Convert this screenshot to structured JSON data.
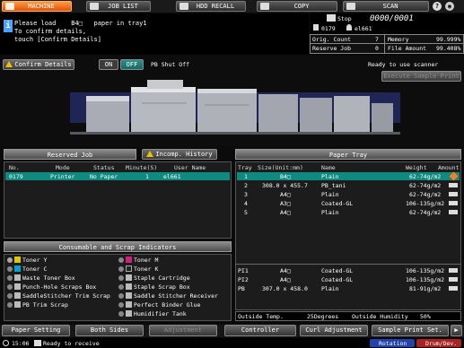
{
  "tabs": {
    "machine": "MACHINE",
    "job_list": "JOB LIST",
    "hdd_recall": "HDD RECALL",
    "copy": "COPY",
    "scan": "SCAN"
  },
  "message": {
    "line1": "Please load    B4□   paper in tray1",
    "line2": "To confirm details,",
    "line3": "touch [Confirm Details]"
  },
  "status": {
    "state": "Stop",
    "counter": "0000/0001",
    "job_id": "0179",
    "user": "el661",
    "orig_count_label": "Orig. Count",
    "orig_count": "7",
    "memory_label": "Memory",
    "memory": "99.999%",
    "reserve_job_label": "Reserve Job",
    "reserve_job": "0",
    "file_amount_label": "File Amount",
    "file_amount": "99.408%"
  },
  "controls": {
    "confirm_details": "Confirm Details",
    "on": "ON",
    "off": "OFF",
    "pb_shut_off": "PB Shut Off",
    "scanner_status": "Ready to use scanner",
    "execute_sample_print": "Execute Sample Print"
  },
  "reserved_job": {
    "title": "Reserved Job",
    "incomp_history": "Incomp. History",
    "headers": [
      "No.",
      "Mode",
      "Status",
      "Minute(S)",
      "User Name"
    ],
    "rows": [
      {
        "no": "0179",
        "mode": "Printer",
        "status": "No Paper",
        "minutes": "1",
        "user": "el661"
      }
    ]
  },
  "consumables": {
    "title": "Consumable and Scrap Indicators",
    "left": [
      "Toner Y",
      "Toner C",
      "Waste Toner Box",
      "Punch-Hole Scraps Box",
      "SaddleStitcher Trim Scrap",
      "PB Trim Scrap"
    ],
    "right": [
      "Toner M",
      "Toner K",
      "Staple Cartridge",
      "Staple Scrap Box",
      "Saddle Stitcher Receiver",
      "Perfect Binder Glue",
      "Humidifier Tank"
    ]
  },
  "paper_tray": {
    "title": "Paper Tray",
    "headers": [
      "Tray",
      "Size(Unit:mm)",
      "Name",
      "Weight",
      "Amount"
    ],
    "rows": [
      {
        "tray": "1",
        "size": "B4□",
        "name": "Plain",
        "weight": "62-74g/m2"
      },
      {
        "tray": "2",
        "size": "308.0 x 455.7",
        "name": "PB_tani",
        "weight": "62-74g/m2"
      },
      {
        "tray": "3",
        "size": "A4□",
        "name": "Plain",
        "weight": "62-74g/m2"
      },
      {
        "tray": "4",
        "size": "A3□",
        "name": "Coated-GL",
        "weight": "106-135g/m2"
      },
      {
        "tray": "5",
        "size": "A4□",
        "name": "Plain",
        "weight": "62-74g/m2"
      }
    ],
    "lower_rows": [
      {
        "tray": "PI1",
        "size": "A4□",
        "name": "Coated-GL",
        "weight": "106-135g/m2"
      },
      {
        "tray": "PI2",
        "size": "A4□",
        "name": "Coated-GL",
        "weight": "106-135g/m2"
      },
      {
        "tray": "PB",
        "size": "307.0 x 458.0",
        "name": "Plain",
        "weight": "81-91g/m2"
      }
    ],
    "outside_temp_label": "Outside Temp.",
    "outside_temp": "25Degrees",
    "outside_humidity_label": "Outside Humidity",
    "outside_humidity": "50%"
  },
  "bottom": {
    "paper_setting": "Paper Setting",
    "both_sides": "Both Sides",
    "adjustment": "Adjustment",
    "controller": "Controller",
    "curl_adjustment": "Curl Adjustment",
    "sample_print_set": "Sample Print Set."
  },
  "statusline": {
    "time": "15:06",
    "message": "Ready to receive",
    "rotation": "Rotation",
    "drum_dev": "Drum/Dev."
  },
  "colors": {
    "accent": "#e2520c",
    "selected_row": "#0f8a80",
    "info": "#4da3ff"
  }
}
